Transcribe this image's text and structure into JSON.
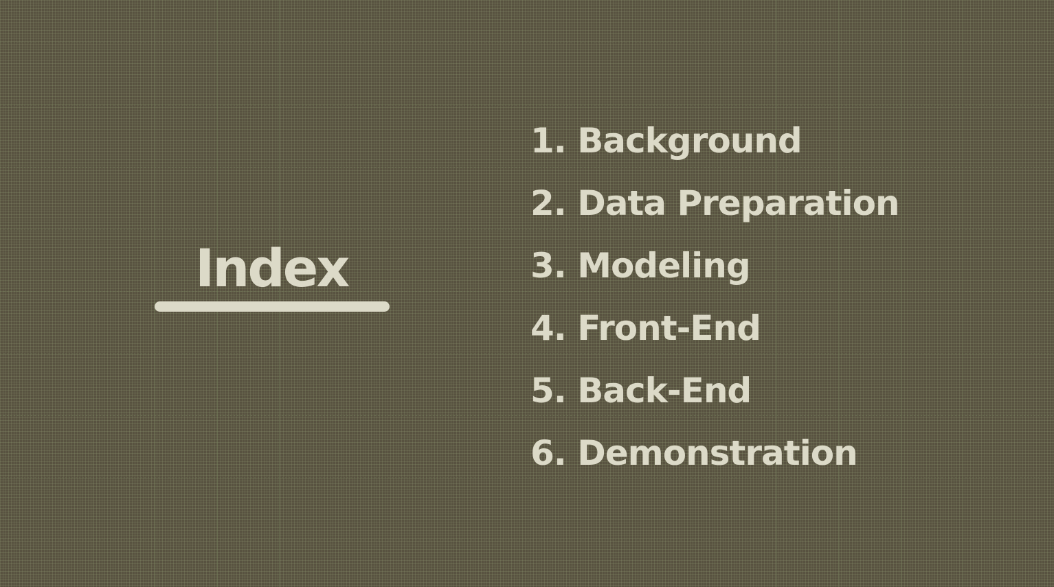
{
  "slide": {
    "title": "Index",
    "items": [
      "1. Background",
      "2. Data Preparation",
      "3. Modeling",
      "4. Front-End",
      "5. Back-End",
      "6. Demonstration"
    ]
  },
  "colors": {
    "background": "#585240",
    "text": "#dcdac8",
    "grid": "#707858"
  }
}
